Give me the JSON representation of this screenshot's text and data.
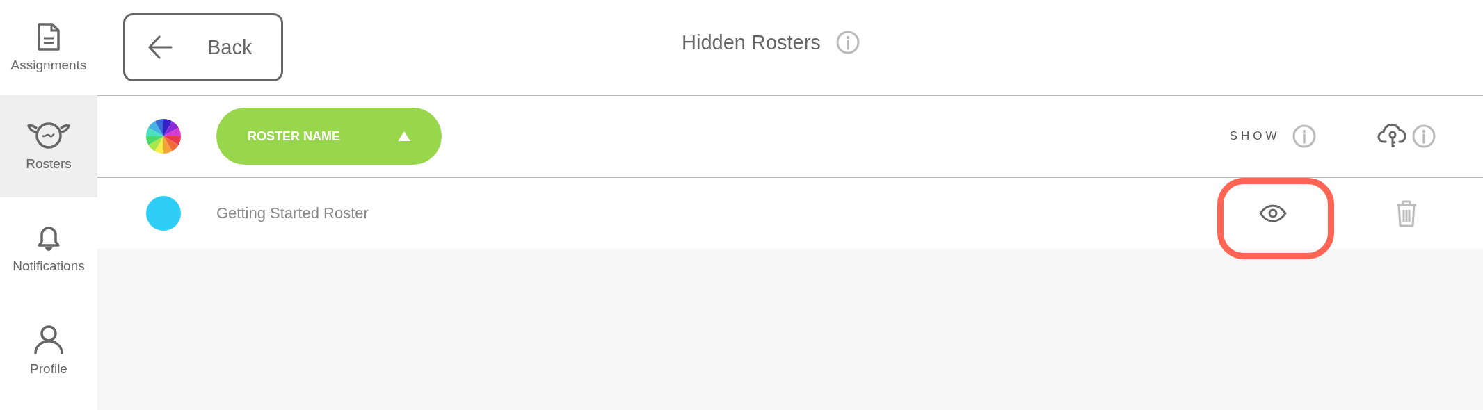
{
  "sidebar": {
    "items": [
      {
        "label": "Assignments",
        "kind": "document",
        "selected": false
      },
      {
        "label": "Rosters",
        "kind": "sheep",
        "selected": true
      },
      {
        "label": "Notifications",
        "kind": "bell",
        "selected": false
      },
      {
        "label": "Profile",
        "kind": "person",
        "selected": false
      }
    ]
  },
  "header": {
    "back_button": "Back",
    "title": "Hidden Rosters"
  },
  "table": {
    "sort_button": {
      "label": "ROSTER NAME",
      "ascending": true
    },
    "show_column": "SHOW",
    "rows": [
      {
        "name": "Getting Started Roster",
        "color": "#2ecdf5",
        "show_highlighted": true
      }
    ]
  }
}
